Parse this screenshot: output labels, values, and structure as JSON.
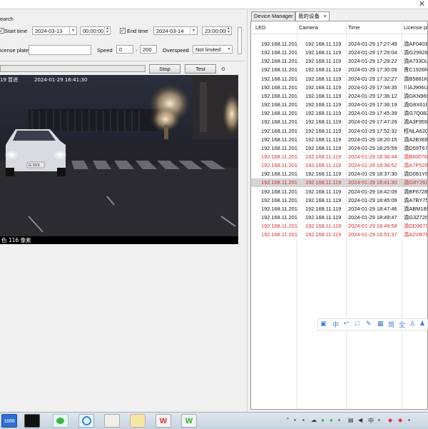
{
  "search": {
    "group_label": "earch",
    "start_label": "Start time",
    "start_date": "2024-03-13",
    "start_time": "00:00:00",
    "end_label": "End time",
    "end_date": "2024-03-14",
    "end_time": "23:00:00",
    "plate_label": "icense plate",
    "plate_value": "",
    "speed_label": "Speed",
    "speed_min": "0",
    "speed_dash": "-",
    "speed_max": "200",
    "overspeed_label": "Overspeed",
    "overspeed_value": "Not limited"
  },
  "controls": {
    "stop_label": "Stop",
    "test_label": "Test",
    "count": "0",
    "progress": 0.0
  },
  "video": {
    "timestamp_prefix": "19 暂进",
    "timestamp": "2024-01-29 16:41:30",
    "caption": "色 116 像素",
    "plate_overlay": "G 0V3"
  },
  "tabs": [
    {
      "label": "Device Manager",
      "active": false
    },
    {
      "label": "我的设备",
      "active": true,
      "close": "×"
    }
  ],
  "table": {
    "columns": [
      "LED",
      "Camera",
      "Time",
      "License pla"
    ],
    "rows": [
      {
        "led": "192.168.11.201",
        "camera": "192.168.11.119",
        "time": "2024-01-29 17:27:49",
        "plate": "渝AF0403C",
        "style": "normal"
      },
      {
        "led": "192.168.11.201",
        "camera": "192.168.11.119",
        "time": "2024-01-29 17:29:04",
        "plate": "渝G29928",
        "style": "normal"
      },
      {
        "led": "192.168.11.201",
        "camera": "192.168.11.119",
        "time": "2024-01-29 17:29:22",
        "plate": "渝A733DL",
        "style": "normal"
      },
      {
        "led": "192.168.11.201",
        "camera": "192.168.11.119",
        "time": "2024-01-29 17:30:09",
        "plate": "贵C1926R",
        "style": "normal"
      },
      {
        "led": "192.168.11.201",
        "camera": "192.168.11.119",
        "time": "2024-01-29 17:32:27",
        "plate": "渝B5881K",
        "style": "normal"
      },
      {
        "led": "192.168.11.201",
        "camera": "192.168.11.119",
        "time": "2024-01-29 17:34:35",
        "plate": "川AJ906U",
        "style": "normal"
      },
      {
        "led": "192.168.11.201",
        "camera": "192.168.11.119",
        "time": "2024-01-29 17:36:12",
        "plate": "渝GKN969",
        "style": "normal"
      },
      {
        "led": "192.168.11.201",
        "camera": "192.168.11.119",
        "time": "2024-01-29 17:36:19",
        "plate": "渝G8X618",
        "style": "normal"
      },
      {
        "led": "192.168.11.201",
        "camera": "192.168.11.119",
        "time": "2024-01-29 17:45:39",
        "plate": "渝G7Q082",
        "style": "normal"
      },
      {
        "led": "192.168.11.201",
        "camera": "192.168.11.119",
        "time": "2024-01-29 17:47:26",
        "plate": "渝A3F955",
        "style": "normal"
      },
      {
        "led": "192.168.11.201",
        "camera": "192.168.11.119",
        "time": "2024-01-29 17:52:32",
        "plate": "桂NLA620",
        "style": "normal"
      },
      {
        "led": "192.168.11.201",
        "camera": "192.168.11.119",
        "time": "2024-01-29 18:20:15",
        "plate": "渝A2B369",
        "style": "normal"
      },
      {
        "led": "192.168.11.201",
        "camera": "192.168.11.119",
        "time": "2024-01-29 18:25:59",
        "plate": "渝D59T67",
        "style": "normal"
      },
      {
        "led": "192.168.11.201",
        "camera": "192.168.11.119",
        "time": "2024-01-29 18:36:44",
        "plate": "渝B60078",
        "style": "red"
      },
      {
        "led": "192.168.11.201",
        "camera": "192.168.11.119",
        "time": "2024-01-29 18:36:52",
        "plate": "渝A7P526",
        "style": "red"
      },
      {
        "led": "192.168.11.201",
        "camera": "192.168.11.119",
        "time": "2024-01-29 18:37:30",
        "plate": "渝D081Y6",
        "style": "normal"
      },
      {
        "led": "192.168.11.201",
        "camera": "192.168.11.119",
        "time": "2024-01-29 18:41:30",
        "plate": "渝G8Y263",
        "style": "selected"
      },
      {
        "led": "192.168.11.201",
        "camera": "192.168.11.119",
        "time": "2024-01-29 18:42:09",
        "plate": "渝BF6728",
        "style": "normal"
      },
      {
        "led": "192.168.11.201",
        "camera": "192.168.11.119",
        "time": "2024-01-29 18:45:09",
        "plate": "渝A7BY75",
        "style": "normal"
      },
      {
        "led": "192.168.11.201",
        "camera": "192.168.11.119",
        "time": "2024-01-29 18:47:46",
        "plate": "渝ABM189",
        "style": "normal"
      },
      {
        "led": "192.168.11.201",
        "camera": "192.168.11.119",
        "time": "2024-01-29 18:49:47",
        "plate": "渝G3Z726",
        "style": "normal"
      },
      {
        "led": "192.168.11.201",
        "camera": "192.168.11.119",
        "time": "2024-01-29 18:49:58",
        "plate": "渝DD3673",
        "style": "red"
      },
      {
        "led": "192.168.11.201",
        "camera": "192.168.11.119",
        "time": "2024-01-29 18:51:37",
        "plate": "渝A2VB78",
        "style": "red"
      }
    ]
  },
  "floating_toolbar": {
    "icons": [
      "ime-icon",
      "中",
      "dot-icon",
      "note-icon",
      "pen-icon",
      "grid-icon",
      "简",
      "全",
      "shirt-icon",
      "user-icon"
    ],
    "ime_label": "中",
    "simplified_label": "简",
    "full_label": "全"
  },
  "taskbar": {
    "badge": "1688",
    "apps": [
      "terminal-icon",
      "wechat-icon",
      "browser-icon",
      "tools-icon",
      "folder-icon",
      "app-w-icon",
      "app-w2-icon"
    ]
  },
  "colors": {
    "red_row": "#d42f2f",
    "selected_row": "#d6d6d6",
    "accent": "#3a7bd5"
  }
}
